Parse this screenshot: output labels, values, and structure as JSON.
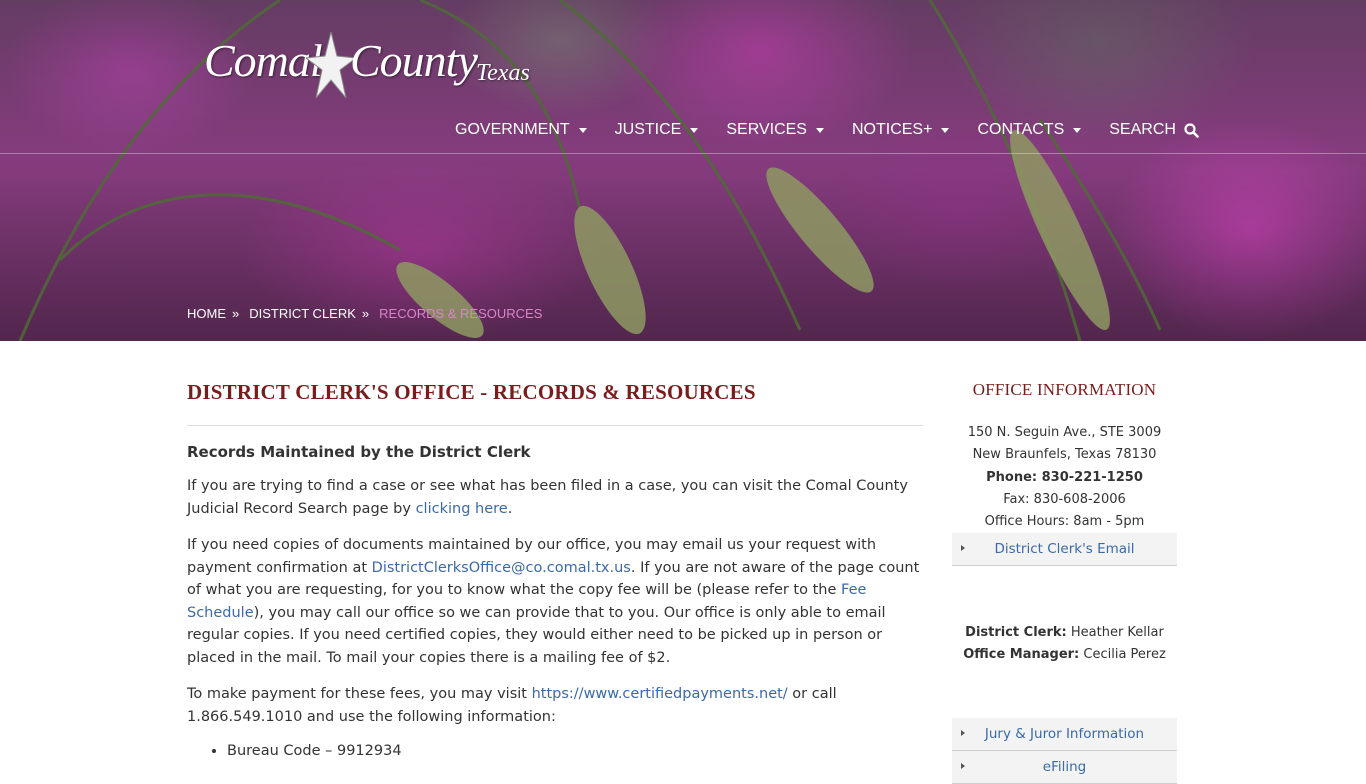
{
  "logo": {
    "word1": "Comal",
    "word2": "County",
    "word3": "Texas"
  },
  "nav": {
    "items": [
      {
        "label": "GOVERNMENT"
      },
      {
        "label": "JUSTICE"
      },
      {
        "label": "SERVICES"
      },
      {
        "label": "NOTICES+"
      },
      {
        "label": "CONTACTS"
      }
    ],
    "search_label": "SEARCH"
  },
  "breadcrumb": {
    "home": "HOME",
    "parent": "DISTRICT CLERK",
    "current": "RECORDS & RESOURCES",
    "separator": "»"
  },
  "main": {
    "title": "DISTRICT CLERK'S OFFICE - RECORDS & RESOURCES",
    "section_heading": "Records Maintained by the District Clerk",
    "p1": {
      "text": "If you are trying to find a case or see what has been filed in a case, you can visit the Comal County Judicial Record Search page by ",
      "link": "clicking here",
      "end": "."
    },
    "p2": {
      "text1": "If you need copies of documents maintained by our office, you may email us your request with payment confirmation at ",
      "email": "DistrictClerksOffice@co.comal.tx.us",
      "text2": ". If you are not aware of the page count of what you are requesting, for you to know what the copy fee will be (please refer to the ",
      "fee_link": "Fee Schedule",
      "text3": "), you may call our office so we can provide that to you. Our office is only able to email regular copies. If you need certified copies, they would either need to be picked up in person or placed in the mail. To mail your copies there is a mailing fee of $2."
    },
    "p3": {
      "text1": "To make payment for these fees, you may visit ",
      "link": "https://www.certifiedpayments.net/",
      "text2": " or call 1.866.549.1010 and use the following information:"
    },
    "bullets": [
      "Bureau Code – 9912934"
    ]
  },
  "sidebar": {
    "title": "OFFICE INFORMATION",
    "address1": "150 N. Seguin Ave., STE 3009",
    "address2": "New Braunfels, Texas 78130",
    "phone": "Phone: 830-221-1250",
    "fax": "Fax: 830-608-2006",
    "hours": "Office Hours: 8am - 5pm",
    "email_link": "District Clerk's Email",
    "clerk_label": "District Clerk:",
    "clerk_name": " Heather Kellar",
    "manager_label": "Office Manager:",
    "manager_name": " Cecilia Perez",
    "links": [
      "Jury & Juror Information",
      "eFiling"
    ]
  },
  "colors": {
    "title_red": "#7a1c1c",
    "link_blue": "#3a6aa8",
    "breadcrumb_current": "#d985c9"
  }
}
